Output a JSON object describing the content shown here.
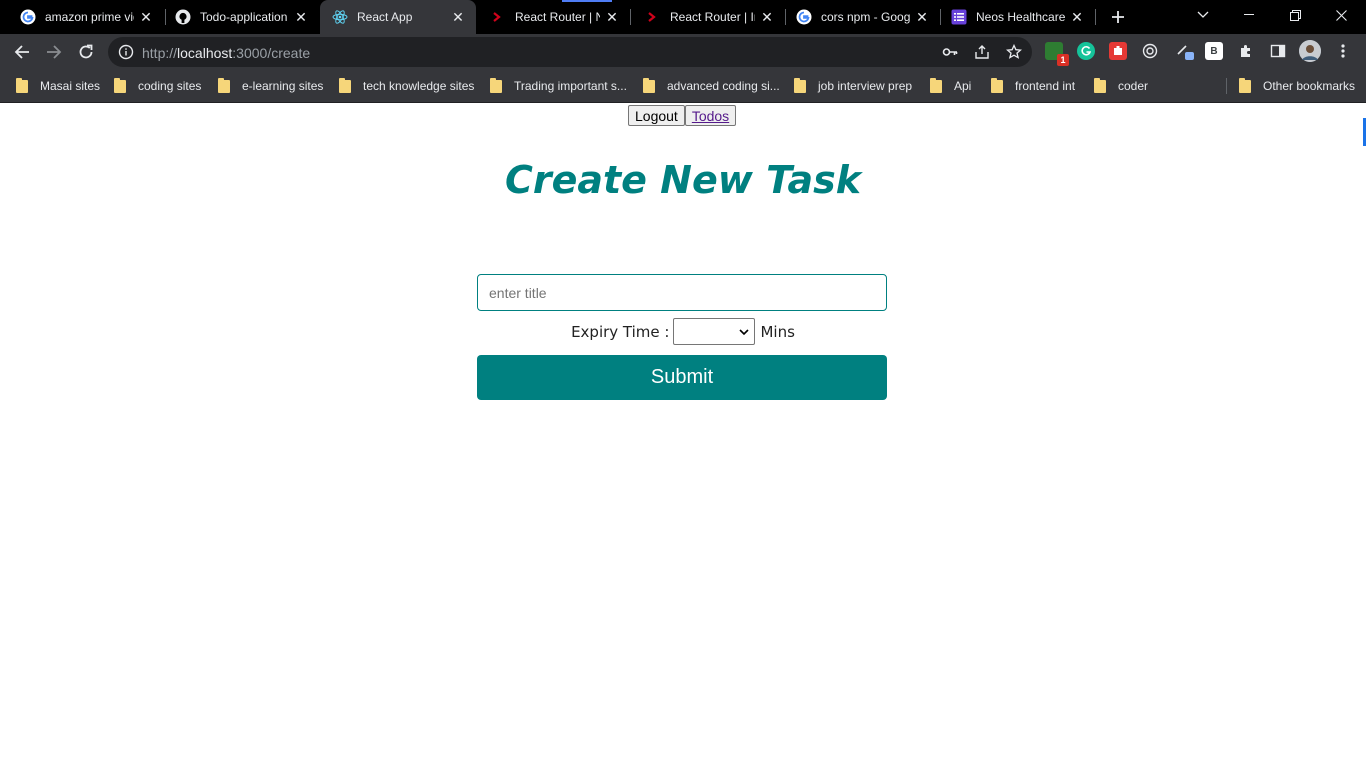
{
  "browser": {
    "tabs": [
      {
        "title": "amazon prime video",
        "icon": "google-icon"
      },
      {
        "title": "Todo-application",
        "icon": "github-icon"
      },
      {
        "title": "React App",
        "icon": "react-icon",
        "active": true
      },
      {
        "title": "React Router | Navigation",
        "icon": "react-router-icon"
      },
      {
        "title": "React Router | Install",
        "icon": "react-router-icon"
      },
      {
        "title": "cors npm - Google",
        "icon": "google-icon"
      },
      {
        "title": "Neos Healthcare",
        "icon": "list-icon"
      }
    ],
    "url_scheme": "http://",
    "url_host": "localhost",
    "url_path": ":3000/create",
    "extension_badge": "1",
    "extension_b_label": "B",
    "bookmarks": [
      "Masai sites",
      "coding sites",
      "e-learning sites",
      "tech knowledge sites",
      "Trading important s...",
      "advanced coding si...",
      "job interview prep",
      "Api",
      "frontend int",
      "coder"
    ],
    "other_bookmarks": "Other bookmarks"
  },
  "page": {
    "nav": {
      "logout_label": "Logout",
      "todos_label": "Todos"
    },
    "heading": "Create New Task",
    "title_input": {
      "placeholder": "enter title",
      "value": ""
    },
    "expiry": {
      "label": "Expiry Time :",
      "selected": "",
      "unit": "Mins"
    },
    "submit_label": "Submit"
  },
  "colors": {
    "accent": "#008080",
    "tab_bg": "#000000",
    "toolbar_bg": "#35363a"
  }
}
